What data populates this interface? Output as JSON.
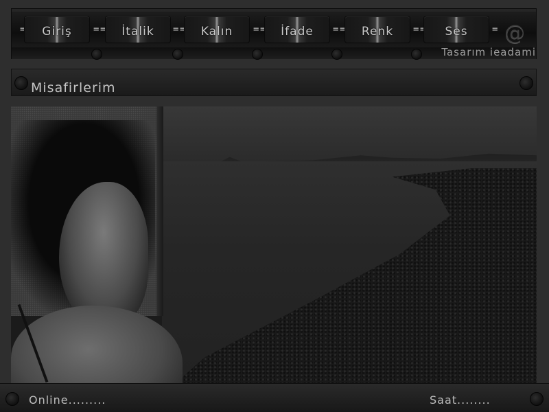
{
  "nav": {
    "separator": "=",
    "items": [
      {
        "label": "Giriş"
      },
      {
        "label": "İtalik"
      },
      {
        "label": "Kalın"
      },
      {
        "label": "İfade"
      },
      {
        "label": "Renk"
      },
      {
        "label": "Ses"
      }
    ],
    "at_symbol": "@",
    "credit": "Tasarım ieadami"
  },
  "title": {
    "text": "Misafirlerim"
  },
  "hero": {
    "image": "woman-by-the-sea-photo"
  },
  "footer": {
    "online": "Online.........",
    "saat": "Saat........"
  },
  "icons": {
    "at": "at-icon",
    "rivet": "rivet-icon"
  }
}
